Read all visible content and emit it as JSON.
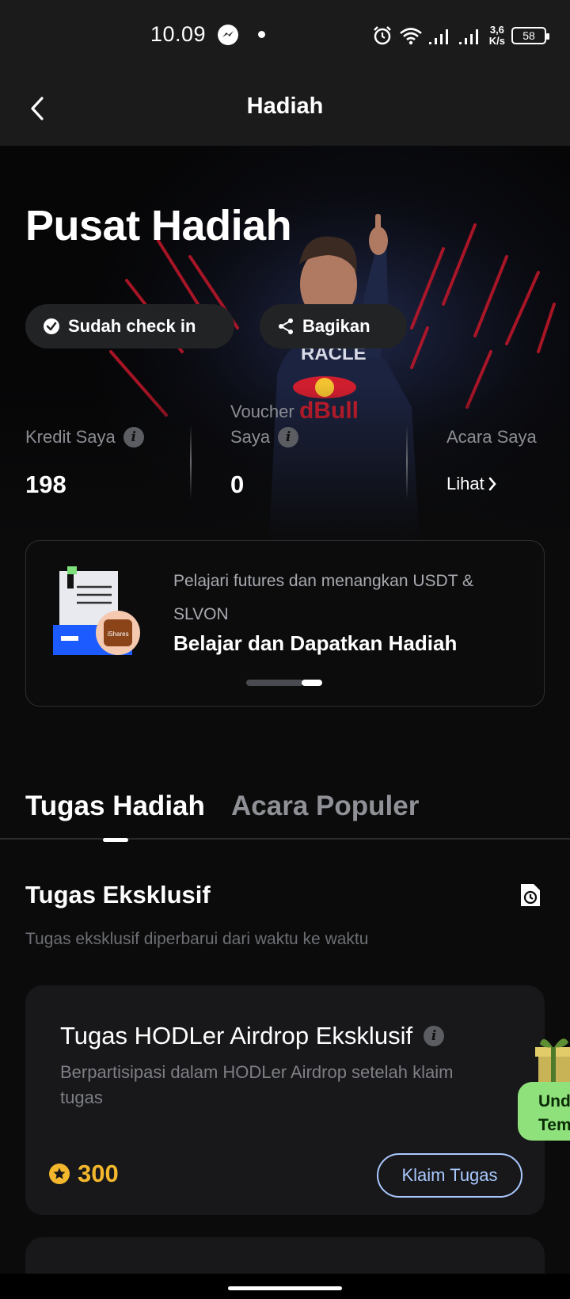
{
  "status_bar": {
    "time": "10.09",
    "net_speed_value": "3,6",
    "net_speed_unit": "K/s",
    "battery": "58"
  },
  "header": {
    "title": "Hadiah"
  },
  "hero": {
    "title": "Pusat Hadiah",
    "checkin_label": "Sudah check in",
    "share_label": "Bagikan",
    "stats": {
      "credit_label": "Kredit Saya",
      "credit_value": "198",
      "voucher_label_line1": "Voucher",
      "voucher_label_line2": "Saya",
      "voucher_value": "0",
      "events_label": "Acara Saya",
      "events_link": "Lihat"
    }
  },
  "banner": {
    "subtitle": "Pelajari futures dan menangkan USDT & SLVON",
    "title": "Belajar dan Dapatkan Hadiah",
    "badge_text": "iShares"
  },
  "tabs": [
    {
      "label": "Tugas Hadiah",
      "active": true
    },
    {
      "label": "Acara Populer",
      "active": false
    }
  ],
  "section": {
    "title": "Tugas Eksklusif",
    "subtitle": "Tugas eksklusif diperbarui dari waktu ke waktu"
  },
  "task": {
    "title": "Tugas HODLer Airdrop Eksklusif",
    "description": "Berpartisipasi dalam HODLer Airdrop setelah klaim tugas",
    "reward": "300",
    "button": "Klaim Tugas"
  },
  "side_badge": {
    "line1": "Und",
    "line2": "Tem"
  },
  "colors": {
    "background": "#0b0b0c",
    "card": "#18181a",
    "reward": "#f3b72d",
    "claim_outline": "#a9c8ff",
    "badge_green": "#8fe17b"
  }
}
